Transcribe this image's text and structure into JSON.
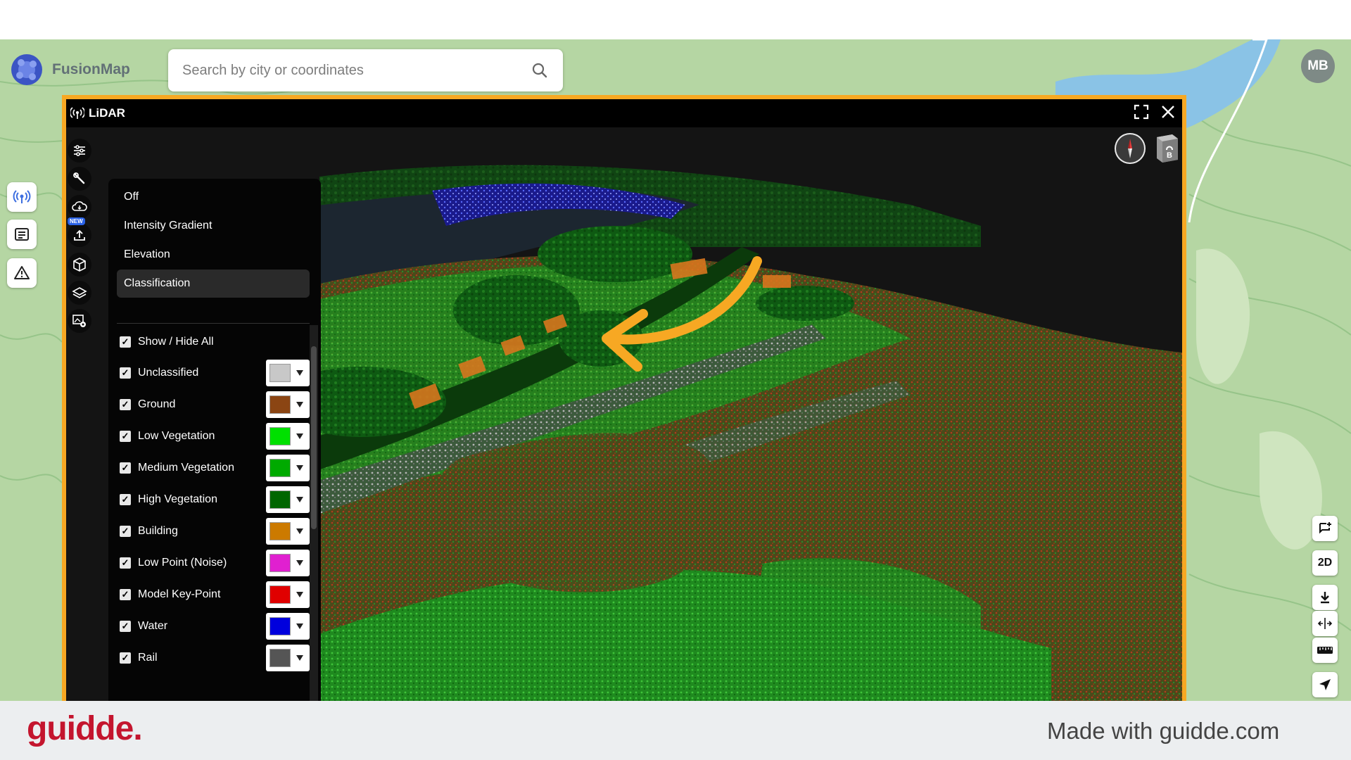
{
  "app": {
    "name": "FusionMap"
  },
  "search": {
    "placeholder": "Search by city or coordinates"
  },
  "user": {
    "initials": "MB"
  },
  "left_buttons": [
    {
      "icon": "antenna-icon",
      "active": true
    },
    {
      "icon": "document-icon"
    },
    {
      "icon": "warning-icon"
    }
  ],
  "lidar_window": {
    "title": "LiDAR",
    "tools": [
      {
        "icon": "sliders-icon"
      },
      {
        "icon": "wrench-icon"
      },
      {
        "icon": "cloud-download-icon"
      },
      {
        "icon": "upload-icon",
        "badge": "NEW"
      },
      {
        "icon": "cube-icon"
      },
      {
        "icon": "layers-icon"
      },
      {
        "icon": "image-settings-icon"
      }
    ],
    "color_modes": [
      "Off",
      "Intensity Gradient",
      "Elevation",
      "Classification"
    ],
    "selected_mode": "Classification",
    "classes": [
      {
        "label": "Show / Hide All",
        "checked": true
      },
      {
        "label": "Unclassified",
        "checked": true,
        "color": "#c8c8c8"
      },
      {
        "label": "Ground",
        "checked": true,
        "color": "#8b4513"
      },
      {
        "label": "Low Vegetation",
        "checked": true,
        "color": "#00e000"
      },
      {
        "label": "Medium Vegetation",
        "checked": true,
        "color": "#00aa00"
      },
      {
        "label": "High Vegetation",
        "checked": true,
        "color": "#006600"
      },
      {
        "label": "Building",
        "checked": true,
        "color": "#cc7a00"
      },
      {
        "label": "Low Point (Noise)",
        "checked": true,
        "color": "#e020d0"
      },
      {
        "label": "Model Key-Point",
        "checked": true,
        "color": "#e00000"
      },
      {
        "label": "Water",
        "checked": true,
        "color": "#0000dd"
      },
      {
        "label": "Rail",
        "checked": true,
        "color": "#555555"
      }
    ],
    "navcube_label": "B"
  },
  "map_controls": [
    {
      "icon": "add-comment-icon"
    },
    {
      "label": "2D"
    },
    {
      "icon": "download-icon"
    },
    {
      "icon": "split-view-icon"
    },
    {
      "icon": "ruler-icon"
    },
    {
      "icon": "navigate-arrow-icon"
    }
  ],
  "accent_colors": {
    "highlight": "#f7a823",
    "brand": "#c4152e"
  },
  "footer": {
    "brand": "guidde.",
    "made_with": "Made with guidde.com"
  }
}
